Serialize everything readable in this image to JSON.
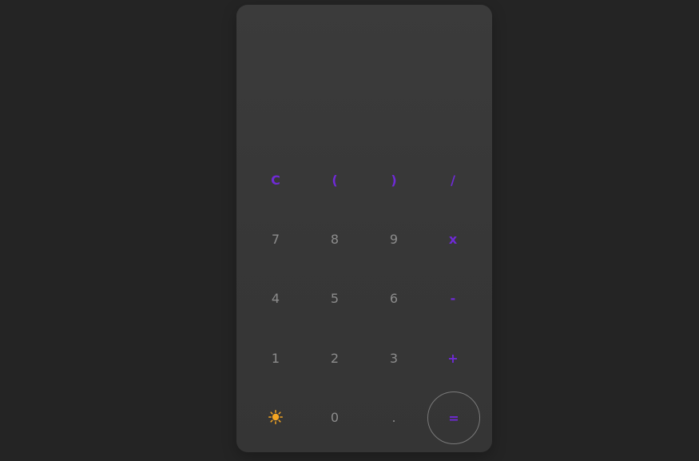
{
  "calculator": {
    "display": {
      "value": ""
    },
    "keys": {
      "clear": "C",
      "open_paren": "(",
      "close_paren": ")",
      "divide": "/",
      "seven": "7",
      "eight": "8",
      "nine": "9",
      "multiply": "x",
      "four": "4",
      "five": "5",
      "six": "6",
      "subtract": "-",
      "one": "1",
      "two": "2",
      "three": "3",
      "add": "+",
      "zero": "0",
      "decimal": ".",
      "equals": "="
    },
    "theme_toggle_icon": "sun-icon",
    "colors": {
      "background": "#242424",
      "panel": "#393939",
      "digit_text": "#8c8c8c",
      "operator_text": "#6f2ad6",
      "sun_icon": "#f4a522",
      "equals_ring": "#7a7a7a"
    }
  }
}
